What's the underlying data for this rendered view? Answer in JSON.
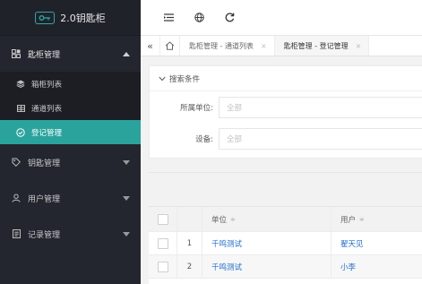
{
  "app": {
    "title": "2.0钥匙柜"
  },
  "sidebar": {
    "groups": [
      {
        "label": "匙柜管理",
        "expanded": true,
        "items": [
          {
            "label": "箱柜列表",
            "active": false
          },
          {
            "label": "通道列表",
            "active": false
          },
          {
            "label": "登记管理",
            "active": true
          }
        ]
      },
      {
        "label": "钥匙管理",
        "expanded": false
      },
      {
        "label": "用户管理",
        "expanded": false
      },
      {
        "label": "记录管理",
        "expanded": false
      }
    ]
  },
  "tabs": [
    {
      "label": "匙柜管理 - 通道列表",
      "close": "×",
      "active": false
    },
    {
      "label": "匙柜管理 - 登记管理",
      "close": "×",
      "active": true
    }
  ],
  "search": {
    "title": "搜索条件",
    "fields": [
      {
        "label": "所属单位:",
        "placeholder": "全部"
      },
      {
        "label": "设备:",
        "placeholder": "全部"
      }
    ]
  },
  "table": {
    "columns": [
      "单位",
      "用户"
    ],
    "sort_icon": "≑",
    "rows": [
      {
        "num": "1",
        "unit": "千鸣测试",
        "user": "翟天见"
      },
      {
        "num": "2",
        "unit": "千鸣测试",
        "user": "小李"
      }
    ]
  },
  "colors": {
    "accent": "#2aa39d",
    "sidebar_bg": "#23262e",
    "link": "#1e6fd1"
  }
}
